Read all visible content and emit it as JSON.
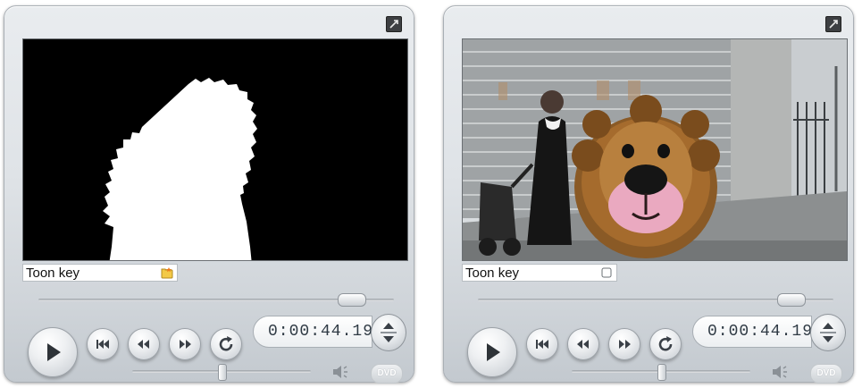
{
  "players": [
    {
      "title": "Toon key",
      "timecode": "0:00:44.19",
      "title_icon": "folder-star-icon",
      "view": "alpha-mask",
      "scrub_position": 0.88,
      "volume_level": 0.5,
      "dvd_label": "DVD"
    },
    {
      "title": "Toon key",
      "timecode": "0:00:44.19",
      "title_icon": "square-checkbox-icon",
      "view": "composited-video",
      "scrub_position": 0.88,
      "volume_level": 0.5,
      "dvd_label": "DVD"
    }
  ],
  "icons": {
    "expand": "expand-icon",
    "play": "play-icon",
    "go_to_start": "go-to-start-icon",
    "rewind": "rewind-icon",
    "fast_forward": "fast-forward-icon",
    "loop": "loop-icon",
    "jog": "up-down-arrows-icon",
    "speaker": "speaker-icon"
  },
  "colors": {
    "panel": "#dfe3e7",
    "timecode_text": "#2f3a44"
  }
}
